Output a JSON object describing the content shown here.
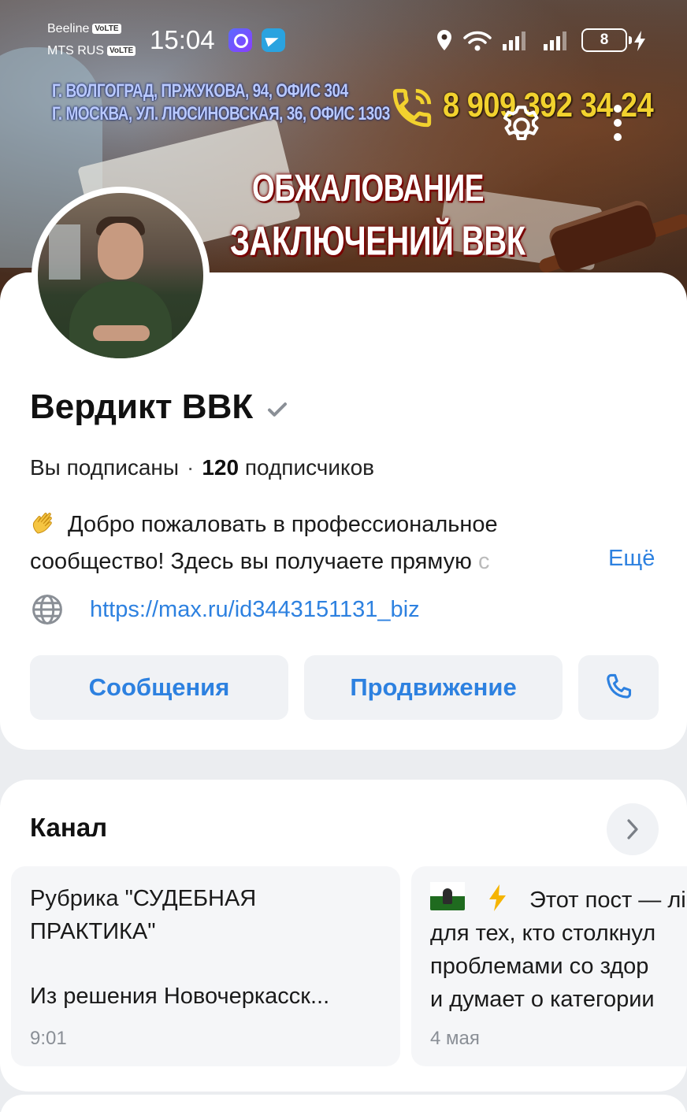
{
  "status_bar": {
    "carrier1": "Beeline",
    "carrier2": "MTS RUS",
    "volte": "VoLTE",
    "time": "15:04",
    "battery": "8"
  },
  "cover": {
    "address1": "Г. ВОЛГОГРАД, ПР.ЖУКОВА, 94, ОФИС 304",
    "address2": "Г. МОСКВА, УЛ. ЛЮСИНОВСКАЯ, 36, ОФИС 1303",
    "phone": "8 909 392 34 24",
    "headline1": "ОБЖАЛОВАНИЕ",
    "headline2": "ЗАКЛЮЧЕНИЙ ВВК"
  },
  "profile": {
    "title": "Вердикт ВВК",
    "subscribed": "Вы подписаны",
    "separator": "·",
    "subscribers_count": "120",
    "subscribers_label": "подписчиков",
    "description_line1": "Добро пожаловать в профессиональное",
    "description_line2": "сообщество! Здесь вы получаете прямую ",
    "description_fade": "с",
    "more_label": "Ещё",
    "link": "https://max.ru/id3443151131_biz"
  },
  "actions": {
    "messages_label": "Сообщения",
    "promotion_label": "Продвижение"
  },
  "channel": {
    "title": "Канал",
    "posts": [
      {
        "title": "Рубрика \"СУДЕБНАЯ\nПРАКТИКА\"",
        "body": "Из решения Новочеркасск...",
        "time": "9:01"
      },
      {
        "line1": "Этот пост — лі",
        "line2": "для тех, кто столкнул",
        "line3": "проблемами со здор",
        "line4": "и думает о категории",
        "time": "4 мая"
      }
    ]
  },
  "colors": {
    "accent": "#2d81e0",
    "background": "#ebedf0",
    "card": "#ffffff",
    "button_bg": "#f0f2f5",
    "cover_phone": "#f2d22e"
  },
  "icons": [
    "location-icon",
    "wifi-icon",
    "signal-icon",
    "battery-icon",
    "charging-icon",
    "settings-icon",
    "more-icon",
    "verified-icon",
    "wave-emoji-icon",
    "globe-icon",
    "phone-icon",
    "chevron-right-icon",
    "lightning-icon"
  ]
}
